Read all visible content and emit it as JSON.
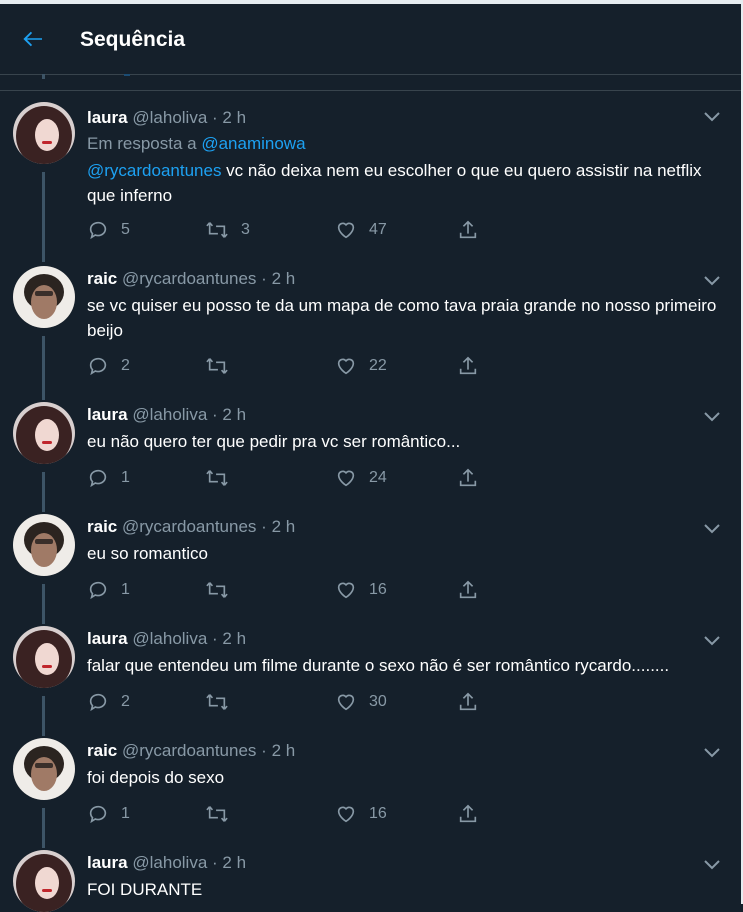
{
  "header": {
    "title": "Sequência"
  },
  "tweets": [
    {
      "name": "laura",
      "handle": "@laholiva",
      "dot": "·",
      "time": "2 h",
      "reply_prefix": "Em resposta a",
      "reply_to": "@anaminowa",
      "mention": "@rycardoantunes",
      "text": " vc não deixa nem eu escolher o que eu quero assistir na netflix que inferno",
      "replies": "5",
      "retweets": "3",
      "likes": "47"
    },
    {
      "name": "raic",
      "handle": "@rycardoantunes",
      "dot": "·",
      "time": "2 h",
      "text": "se vc quiser eu posso te da um mapa de como tava praia grande no nosso primeiro beijo",
      "replies": "2",
      "retweets": "",
      "likes": "22"
    },
    {
      "name": "laura",
      "handle": "@laholiva",
      "dot": "·",
      "time": "2 h",
      "text": "eu não quero ter que pedir pra vc ser romântico...",
      "replies": "1",
      "retweets": "",
      "likes": "24"
    },
    {
      "name": "raic",
      "handle": "@rycardoantunes",
      "dot": "·",
      "time": "2 h",
      "text": "eu so romantico",
      "replies": "1",
      "retweets": "",
      "likes": "16"
    },
    {
      "name": "laura",
      "handle": "@laholiva",
      "dot": "·",
      "time": "2 h",
      "text": "falar que entendeu um filme durante o sexo não é ser romântico rycardo........",
      "replies": "2",
      "retweets": "",
      "likes": "30"
    },
    {
      "name": "raic",
      "handle": "@rycardoantunes",
      "dot": "·",
      "time": "2 h",
      "text": "foi depois do sexo",
      "replies": "1",
      "retweets": "",
      "likes": "16"
    },
    {
      "name": "laura",
      "handle": "@laholiva",
      "dot": "·",
      "time": "2 h",
      "text": "FOI DURANTE"
    }
  ]
}
